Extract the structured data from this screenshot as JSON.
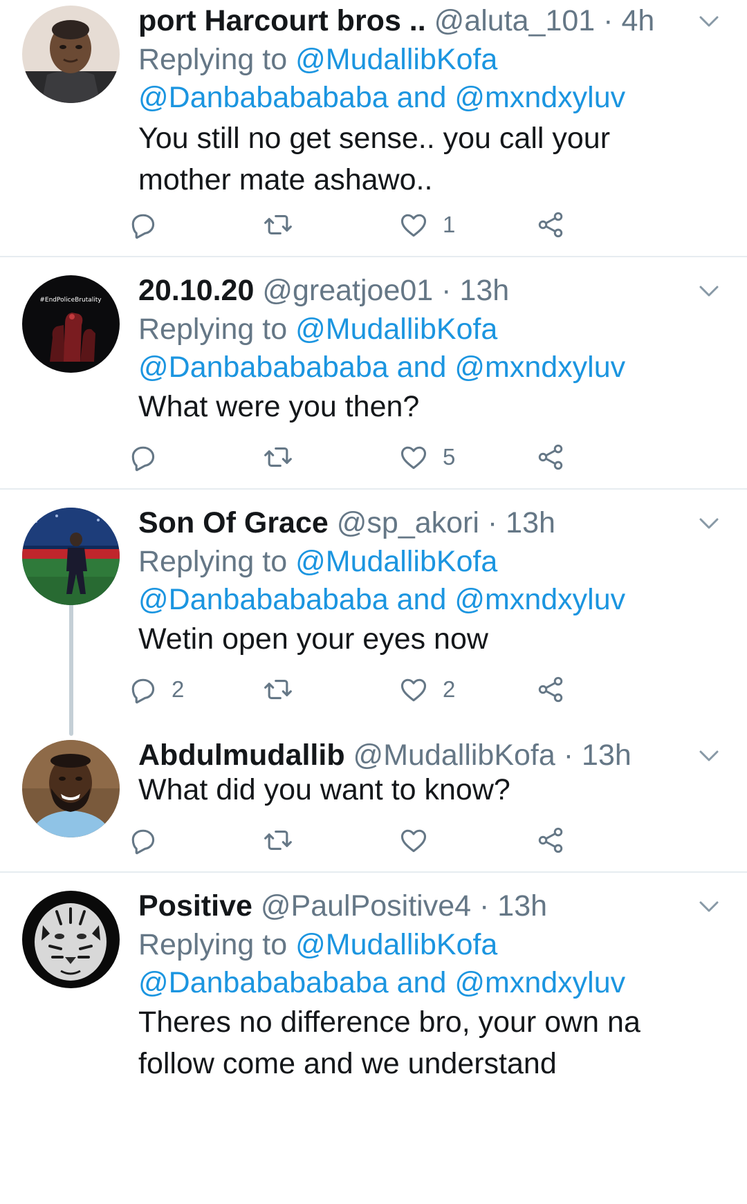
{
  "tweets": [
    {
      "name": "port Harcourt bros ..",
      "handle": "@aluta_101",
      "time": "4h",
      "replying_prefix": "Replying to",
      "replying_first": "@MudallibKofa",
      "replying_second": "@Danbababababa",
      "replying_and": "and",
      "replying_third": "@mxndxyluv",
      "text": "You still no get sense.. you call your mother mate ashawo..",
      "reply_count": "",
      "retweet_count": "",
      "like_count": "1"
    },
    {
      "name": "20.10.20",
      "handle": "@greatjoe01",
      "time": "13h",
      "replying_prefix": "Replying to",
      "replying_first": "@MudallibKofa",
      "replying_second": "@Danbababababa",
      "replying_and": "and",
      "replying_third": "@mxndxyluv",
      "text": "What were you then?",
      "reply_count": "",
      "retweet_count": "",
      "like_count": "5",
      "avatar_text": "#EndPoliceBrutality"
    },
    {
      "name": "Son Of Grace",
      "handle": "@sp_akori",
      "time": "13h",
      "replying_prefix": "Replying to",
      "replying_first": "@MudallibKofa",
      "replying_second": "@Danbababababa",
      "replying_and": "and",
      "replying_third": "@mxndxyluv",
      "text": "Wetin open your eyes now",
      "reply_count": "2",
      "retweet_count": "",
      "like_count": "2"
    },
    {
      "name": "Abdulmudallib",
      "handle": "@MudallibKofa",
      "time": "13h",
      "text": "What did you want to know?",
      "reply_count": "",
      "retweet_count": "",
      "like_count": ""
    },
    {
      "name": "Positive",
      "handle": "@PaulPositive4",
      "time": "13h",
      "replying_prefix": "Replying to",
      "replying_first": "@MudallibKofa",
      "replying_second": "@Danbababababa",
      "replying_and": "and",
      "replying_third": "@mxndxyluv",
      "text": "Theres no difference bro, your own na follow come and we understand"
    }
  ],
  "meta_dot": "·",
  "icons": {
    "reply": "reply-icon",
    "retweet": "retweet-icon",
    "like": "heart-icon",
    "share": "share-icon",
    "menu": "chevron-down-icon"
  },
  "colors": {
    "link": "#1b95e0",
    "secondary": "#657786",
    "separator": "#e6ecf0",
    "thread_line": "#c4cfd6"
  }
}
